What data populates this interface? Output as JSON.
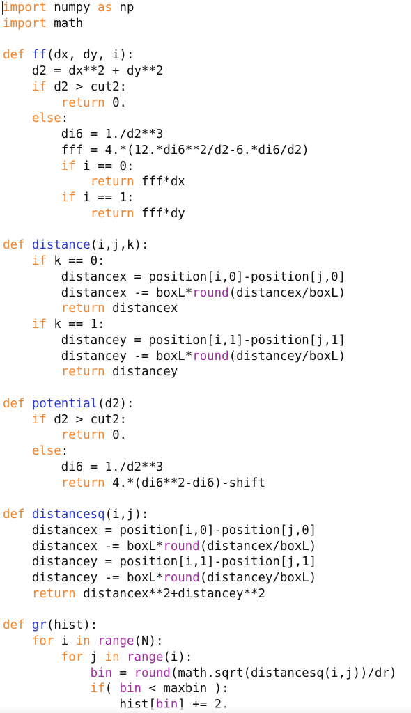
{
  "editor": {
    "language": "python",
    "colors": {
      "keyword": "#f5842a",
      "function_name": "#2b3bd8",
      "builtin": "#a12ca3",
      "text": "#111111",
      "background": "#ffffff"
    },
    "lines": [
      [
        {
          "t": "kw",
          "s": "import"
        },
        {
          "t": "tx",
          "s": " numpy "
        },
        {
          "t": "kw",
          "s": "as"
        },
        {
          "t": "tx",
          "s": " np"
        }
      ],
      [
        {
          "t": "kw",
          "s": "import"
        },
        {
          "t": "tx",
          "s": " math"
        }
      ],
      [],
      [
        {
          "t": "kw",
          "s": "def"
        },
        {
          "t": "tx",
          "s": " "
        },
        {
          "t": "fn",
          "s": "ff"
        },
        {
          "t": "tx",
          "s": "(dx, dy, i):"
        }
      ],
      [
        {
          "t": "tx",
          "s": "    d2 = dx**2 + dy**2"
        }
      ],
      [
        {
          "t": "tx",
          "s": "    "
        },
        {
          "t": "kw",
          "s": "if"
        },
        {
          "t": "tx",
          "s": " d2 > cut2:"
        }
      ],
      [
        {
          "t": "tx",
          "s": "        "
        },
        {
          "t": "kw",
          "s": "return"
        },
        {
          "t": "tx",
          "s": " 0."
        }
      ],
      [
        {
          "t": "tx",
          "s": "    "
        },
        {
          "t": "kw",
          "s": "else"
        },
        {
          "t": "tx",
          "s": ":"
        }
      ],
      [
        {
          "t": "tx",
          "s": "        di6 = 1./d2**3"
        }
      ],
      [
        {
          "t": "tx",
          "s": "        fff = 4.*(12.*di6**2/d2-6.*di6/d2)"
        }
      ],
      [
        {
          "t": "tx",
          "s": "        "
        },
        {
          "t": "kw",
          "s": "if"
        },
        {
          "t": "tx",
          "s": " i == 0:"
        }
      ],
      [
        {
          "t": "tx",
          "s": "            "
        },
        {
          "t": "kw",
          "s": "return"
        },
        {
          "t": "tx",
          "s": " fff*dx"
        }
      ],
      [
        {
          "t": "tx",
          "s": "        "
        },
        {
          "t": "kw",
          "s": "if"
        },
        {
          "t": "tx",
          "s": " i == 1:"
        }
      ],
      [
        {
          "t": "tx",
          "s": "            "
        },
        {
          "t": "kw",
          "s": "return"
        },
        {
          "t": "tx",
          "s": " fff*dy"
        }
      ],
      [],
      [
        {
          "t": "kw",
          "s": "def"
        },
        {
          "t": "tx",
          "s": " "
        },
        {
          "t": "fn",
          "s": "distance"
        },
        {
          "t": "tx",
          "s": "(i,j,k):"
        }
      ],
      [
        {
          "t": "tx",
          "s": "    "
        },
        {
          "t": "kw",
          "s": "if"
        },
        {
          "t": "tx",
          "s": " k == 0:"
        }
      ],
      [
        {
          "t": "tx",
          "s": "        distancex = position[i,0]-position[j,0]"
        }
      ],
      [
        {
          "t": "tx",
          "s": "        distancex -= boxL*"
        },
        {
          "t": "bi",
          "s": "round"
        },
        {
          "t": "tx",
          "s": "(distancex/boxL)"
        }
      ],
      [
        {
          "t": "tx",
          "s": "        "
        },
        {
          "t": "kw",
          "s": "return"
        },
        {
          "t": "tx",
          "s": " distancex"
        }
      ],
      [
        {
          "t": "tx",
          "s": "    "
        },
        {
          "t": "kw",
          "s": "if"
        },
        {
          "t": "tx",
          "s": " k == 1:"
        }
      ],
      [
        {
          "t": "tx",
          "s": "        distancey = position[i,1]-position[j,1]"
        }
      ],
      [
        {
          "t": "tx",
          "s": "        distancey -= boxL*"
        },
        {
          "t": "bi",
          "s": "round"
        },
        {
          "t": "tx",
          "s": "(distancey/boxL)"
        }
      ],
      [
        {
          "t": "tx",
          "s": "        "
        },
        {
          "t": "kw",
          "s": "return"
        },
        {
          "t": "tx",
          "s": " distancey"
        }
      ],
      [],
      [
        {
          "t": "kw",
          "s": "def"
        },
        {
          "t": "tx",
          "s": " "
        },
        {
          "t": "fn",
          "s": "potential"
        },
        {
          "t": "tx",
          "s": "(d2):"
        }
      ],
      [
        {
          "t": "tx",
          "s": "    "
        },
        {
          "t": "kw",
          "s": "if"
        },
        {
          "t": "tx",
          "s": " d2 > cut2:"
        }
      ],
      [
        {
          "t": "tx",
          "s": "        "
        },
        {
          "t": "kw",
          "s": "return"
        },
        {
          "t": "tx",
          "s": " 0."
        }
      ],
      [
        {
          "t": "tx",
          "s": "    "
        },
        {
          "t": "kw",
          "s": "else"
        },
        {
          "t": "tx",
          "s": ":"
        }
      ],
      [
        {
          "t": "tx",
          "s": "        di6 = 1./d2**3"
        }
      ],
      [
        {
          "t": "tx",
          "s": "        "
        },
        {
          "t": "kw",
          "s": "return"
        },
        {
          "t": "tx",
          "s": " 4.*(di6**2-di6)-shift"
        }
      ],
      [],
      [
        {
          "t": "kw",
          "s": "def"
        },
        {
          "t": "tx",
          "s": " "
        },
        {
          "t": "fn",
          "s": "distancesq"
        },
        {
          "t": "tx",
          "s": "(i,j):"
        }
      ],
      [
        {
          "t": "tx",
          "s": "    distancex = position[i,0]-position[j,0]"
        }
      ],
      [
        {
          "t": "tx",
          "s": "    distancex -= boxL*"
        },
        {
          "t": "bi",
          "s": "round"
        },
        {
          "t": "tx",
          "s": "(distancex/boxL)"
        }
      ],
      [
        {
          "t": "tx",
          "s": "    distancey = position[i,1]-position[j,1]"
        }
      ],
      [
        {
          "t": "tx",
          "s": "    distancey -= boxL*"
        },
        {
          "t": "bi",
          "s": "round"
        },
        {
          "t": "tx",
          "s": "(distancey/boxL)"
        }
      ],
      [
        {
          "t": "tx",
          "s": "    "
        },
        {
          "t": "kw",
          "s": "return"
        },
        {
          "t": "tx",
          "s": " distancex**2+distancey**2"
        }
      ],
      [],
      [
        {
          "t": "kw",
          "s": "def"
        },
        {
          "t": "tx",
          "s": " "
        },
        {
          "t": "fn",
          "s": "gr"
        },
        {
          "t": "tx",
          "s": "(hist):"
        }
      ],
      [
        {
          "t": "tx",
          "s": "    "
        },
        {
          "t": "kw",
          "s": "for"
        },
        {
          "t": "tx",
          "s": " i "
        },
        {
          "t": "kw",
          "s": "in"
        },
        {
          "t": "tx",
          "s": " "
        },
        {
          "t": "bi",
          "s": "range"
        },
        {
          "t": "tx",
          "s": "(N):"
        }
      ],
      [
        {
          "t": "tx",
          "s": "        "
        },
        {
          "t": "kw",
          "s": "for"
        },
        {
          "t": "tx",
          "s": " j "
        },
        {
          "t": "kw",
          "s": "in"
        },
        {
          "t": "tx",
          "s": " "
        },
        {
          "t": "bi",
          "s": "range"
        },
        {
          "t": "tx",
          "s": "(i):"
        }
      ],
      [
        {
          "t": "tx",
          "s": "            "
        },
        {
          "t": "bi",
          "s": "bin"
        },
        {
          "t": "tx",
          "s": " = "
        },
        {
          "t": "bi",
          "s": "round"
        },
        {
          "t": "tx",
          "s": "(math.sqrt(distancesq(i,j))/dr)"
        }
      ],
      [
        {
          "t": "tx",
          "s": "            "
        },
        {
          "t": "kw",
          "s": "if"
        },
        {
          "t": "tx",
          "s": "( "
        },
        {
          "t": "bi",
          "s": "bin"
        },
        {
          "t": "tx",
          "s": " < maxbin ):"
        }
      ],
      [
        {
          "t": "tx",
          "s": "                hist["
        },
        {
          "t": "bi",
          "s": "bin"
        },
        {
          "t": "tx",
          "s": "] += 2."
        }
      ]
    ]
  }
}
